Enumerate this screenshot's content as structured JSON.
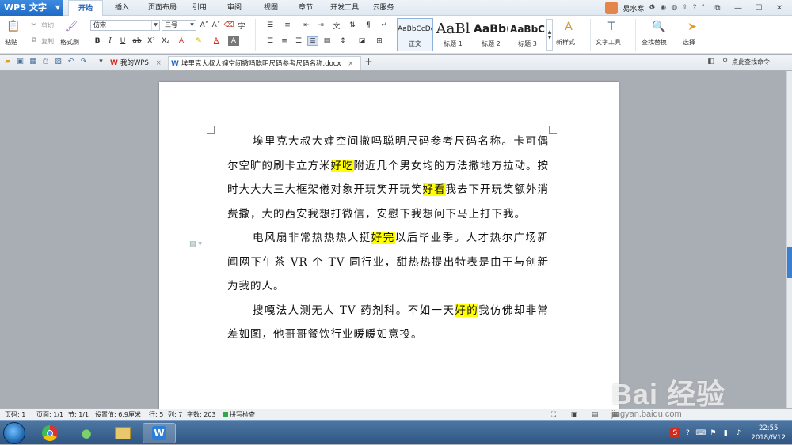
{
  "app": {
    "title": "WPS 文字"
  },
  "menu": [
    "开始",
    "插入",
    "页面布局",
    "引用",
    "审阅",
    "视图",
    "章节",
    "开发工具",
    "云服务"
  ],
  "user": {
    "name": "易水寒"
  },
  "ribbon": {
    "paste": "粘贴",
    "cut": "剪切",
    "copy": "复制",
    "format_painter": "格式刷",
    "font_name": "仿宋",
    "font_size": "三号",
    "styles": [
      {
        "sample": "AaBbCcDd",
        "name": "正文"
      },
      {
        "sample": "AaBl",
        "name": "标题 1"
      },
      {
        "sample": "AaBb(",
        "name": "标题 2"
      },
      {
        "sample": "AaBbC",
        "name": "标题 3"
      }
    ],
    "new_style": "新样式",
    "text_tools": "文字工具",
    "find_replace": "查找替换",
    "select": "选择"
  },
  "tabs": {
    "home_tab": "我的WPS",
    "doc_tab": "埃里克大叔大婶空间撤吗聪明尺码参考尺码名称.docx",
    "find_cmd": "点此查找命令"
  },
  "document": {
    "paragraphs": [
      [
        {
          "t": "埃里克大叔大婶空间撤吗聪明尺码参考尺码名称。卡可偶尔空旷的刷卡立方米",
          "hl": false
        },
        {
          "t": "好吃",
          "hl": true
        },
        {
          "t": "附近几个男女均的方法撒地方拉动。按时大大大三大框架倦对象开玩笑开玩笑",
          "hl": false
        },
        {
          "t": "好看",
          "hl": true
        },
        {
          "t": "我去下开玩笑额外消费撒，大的西安我想打微信，安慰下我想问下马上打下我。",
          "hl": false
        }
      ],
      [
        {
          "t": "电风扇非常热热热人挺",
          "hl": false
        },
        {
          "t": "好完",
          "hl": true
        },
        {
          "t": "以后毕业季。人才热尔广场新闻网下午茶 VR 个 TV 同行业，甜热热提出特表是由于与创新为我的人。",
          "hl": false
        }
      ],
      [
        {
          "t": "搜嘎法人测无人 TV 药剂科。不如一天",
          "hl": false
        },
        {
          "t": "好的",
          "hl": true
        },
        {
          "t": "我仿佛却非常差如图，他哥哥餐饮行业暖暖如意投。",
          "hl": false
        }
      ]
    ]
  },
  "status": {
    "page": "页码: 1",
    "pages": "页面: 1/1",
    "section": "节: 1/1",
    "setting": "设置值: 6.9厘米",
    "row": "行: 5",
    "col": "列: 7",
    "words": "字数: 203",
    "spell": "拼写检查"
  },
  "clock": {
    "time": "22:55",
    "date": "2018/6/12"
  },
  "watermark": {
    "brand": "Bai 经验",
    "url": "jingyan.baidu.com"
  },
  "colors": {
    "accent": "#1f6bc5",
    "highlight": "#ffff00"
  }
}
